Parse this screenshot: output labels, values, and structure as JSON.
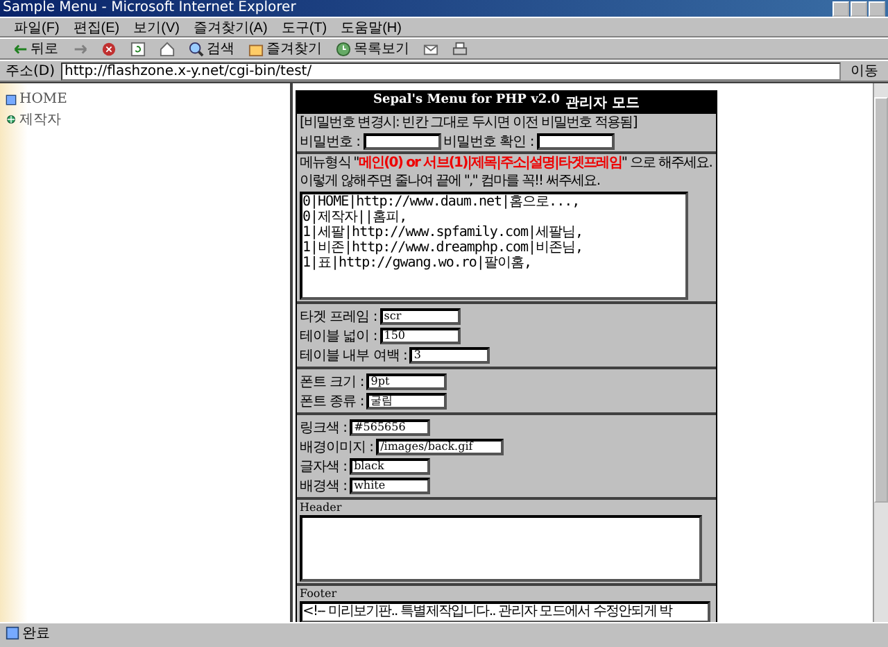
{
  "window": {
    "title": "Sample Menu - Microsoft Internet Explorer"
  },
  "menu": [
    "파일(F)",
    "편집(E)",
    "보기(V)",
    "즐겨찾기(A)",
    "도구(T)",
    "도움말(H)"
  ],
  "toolbar": [
    {
      "kind": "back",
      "label": "뒤로"
    },
    {
      "kind": "forward"
    },
    {
      "kind": "stop"
    },
    {
      "kind": "refresh"
    },
    {
      "kind": "home"
    },
    {
      "kind": "search",
      "label": "검색"
    },
    {
      "kind": "favorites",
      "label": "즐겨찾기"
    },
    {
      "kind": "history",
      "label": "목록보기"
    },
    {
      "kind": "mail"
    },
    {
      "kind": "print"
    }
  ],
  "address": {
    "label": "주소(D)",
    "url": "http://flashzone.x-y.net/cgi-bin/test/",
    "go": "이동"
  },
  "sidebar": {
    "items": [
      {
        "kind": "page",
        "label": "HOME"
      },
      {
        "kind": "link",
        "label": "제작자"
      }
    ]
  },
  "panel": {
    "title": "Sepal's Menu for PHP v2.0",
    "title_suffix": "관리자 모드",
    "password": {
      "note": "[비밀번호 변경시: 빈칸 그대로 두시면 이전 비밀번호 적용됨]",
      "fields": [
        {
          "label": "비밀번호 :"
        },
        {
          "label": "비밀번호 확인 :"
        }
      ]
    },
    "menu_format": {
      "prefix": "메뉴형식 \"",
      "highlight": "메인(0) or 서브(1)|제목|주소|설명|타겟프레임",
      "suffix": "\" 으로 해주세요.",
      "hint": "이렇게 않해주면 줄나여 끝에 \",\" 컴마를 꼭!! 써주세요.",
      "lines": [
        "0|HOME|http://www.daum.net|홈으로...,",
        "0|제작자||홈피,",
        "1|세팔|http://www.spfamily.com|세팔님,",
        "1|비존|http://www.dreamphp.com|비존님,",
        "1|표|http://gwang.wo.ro|팔이홈,"
      ]
    },
    "groups": [
      [
        {
          "label": "타겟 프레임 :",
          "value": "scr"
        },
        {
          "label": "테이블 넓이 :",
          "value": "150"
        },
        {
          "label": "테이블 내부 여백 :",
          "value": "3"
        }
      ],
      [
        {
          "label": "폰트 크기 :",
          "value": "9pt"
        },
        {
          "label": "폰트 종류 :",
          "value": "굴림"
        }
      ],
      [
        {
          "label": "링크색 :",
          "value": "#565656"
        },
        {
          "label": "배경이미지 :",
          "value": "/images/back.gif"
        },
        {
          "label": "글자색 :",
          "value": "black"
        },
        {
          "label": "배경색 :",
          "value": "white"
        }
      ]
    ],
    "header": {
      "label": "Header"
    },
    "footer": {
      "label": "Footer",
      "value": "<!-- 미리보기판.. 특별제작입니다.. 관리자 모드에서 수정안되게 박"
    }
  },
  "status_bar": {
    "text": "완료"
  }
}
